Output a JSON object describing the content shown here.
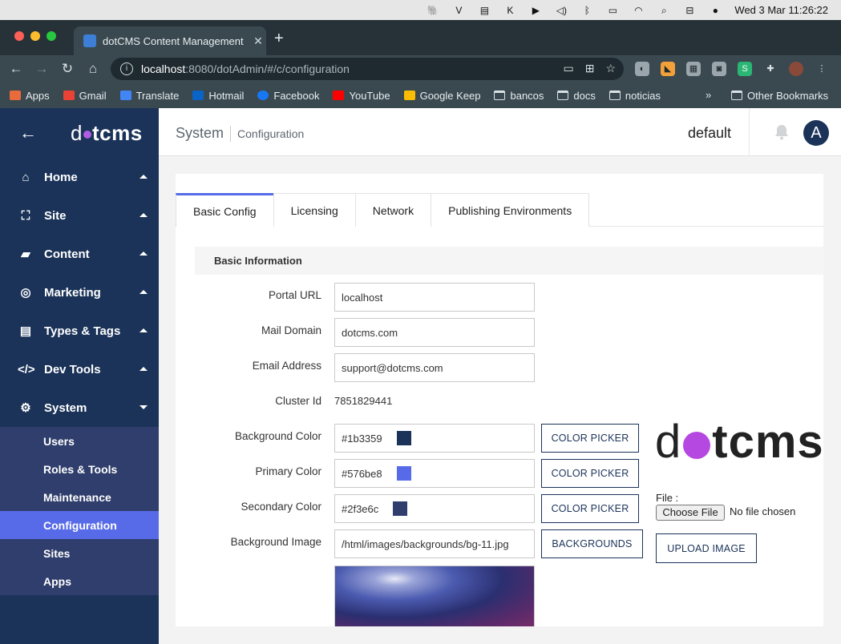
{
  "macbar": {
    "datetime": "Wed 3 Mar  11:26:22"
  },
  "browser": {
    "tab_title": "dotCMS Content Management",
    "url_host": "localhost",
    "url_path": ":8080/dotAdmin/#/c/configuration",
    "bookmarks": [
      "Apps",
      "Gmail",
      "Translate",
      "Hotmail",
      "Facebook",
      "YouTube",
      "Google Keep",
      "bancos",
      "docs",
      "noticias"
    ],
    "other_bookmarks": "Other Bookmarks"
  },
  "sidebar": {
    "logo_left": "d",
    "logo_right": "tcms",
    "items": [
      {
        "label": "Home"
      },
      {
        "label": "Site"
      },
      {
        "label": "Content"
      },
      {
        "label": "Marketing"
      },
      {
        "label": "Types & Tags"
      },
      {
        "label": "Dev Tools"
      },
      {
        "label": "System"
      }
    ],
    "sub_items": [
      {
        "label": "Users"
      },
      {
        "label": "Roles & Tools"
      },
      {
        "label": "Maintenance"
      },
      {
        "label": "Configuration"
      },
      {
        "label": "Sites"
      },
      {
        "label": "Apps"
      }
    ]
  },
  "topbar": {
    "crumb_main": "System",
    "crumb_sub": "Configuration",
    "site": "default",
    "avatar_letter": "A"
  },
  "tabs": [
    "Basic Config",
    "Licensing",
    "Network",
    "Publishing Environments"
  ],
  "section_title": "Basic Information",
  "form": {
    "portal_url": {
      "label": "Portal URL",
      "value": "localhost"
    },
    "mail_domain": {
      "label": "Mail Domain",
      "value": "dotcms.com"
    },
    "email": {
      "label": "Email Address",
      "value": "support@dotcms.com"
    },
    "cluster": {
      "label": "Cluster Id",
      "value": "7851829441"
    },
    "bg_color": {
      "label": "Background Color",
      "value": "#1b3359",
      "color": "#1b3359"
    },
    "primary_color": {
      "label": "Primary Color",
      "value": "#576be8",
      "color": "#576be8"
    },
    "secondary_color": {
      "label": "Secondary Color",
      "value": "#2f3e6c",
      "color": "#2f3e6c"
    },
    "bg_image": {
      "label": "Background Image",
      "value": "/html/images/backgrounds/bg-11.jpg"
    },
    "color_picker": "COLOR PICKER",
    "backgrounds": "BACKGROUNDS",
    "upload_image": "UPLOAD IMAGE",
    "file_label": "File :",
    "choose_file": "Choose File",
    "no_file": "No file chosen"
  },
  "logo_preview": {
    "left": "d",
    "right": "tcms"
  }
}
